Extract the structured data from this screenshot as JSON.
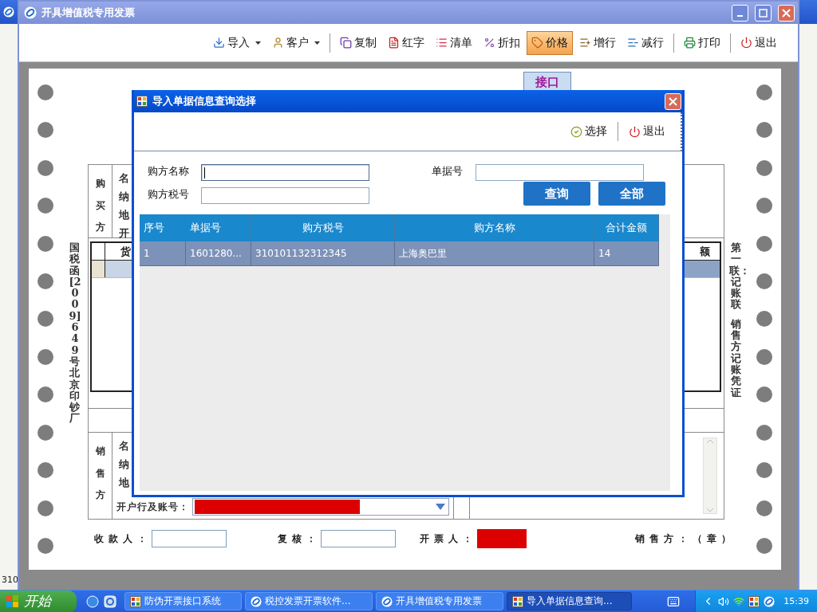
{
  "desktop": {
    "status_text": "310"
  },
  "window": {
    "title": "开具增值税专用发票"
  },
  "toolbar": {
    "groups": [
      [
        {
          "label": "导入",
          "kind": "import",
          "menu": true,
          "selected": false
        },
        {
          "label": "客户",
          "kind": "customer",
          "menu": true,
          "selected": false
        }
      ],
      [
        {
          "label": "复制",
          "kind": "copy",
          "menu": false,
          "selected": false
        },
        {
          "label": "红字",
          "kind": "red",
          "menu": false,
          "selected": false
        },
        {
          "label": "清单",
          "kind": "list",
          "menu": false,
          "selected": false
        },
        {
          "label": "折扣",
          "kind": "discount",
          "menu": false,
          "selected": false
        },
        {
          "label": "价格",
          "kind": "price",
          "menu": false,
          "selected": true
        },
        {
          "label": "增行",
          "kind": "add_row",
          "menu": false,
          "selected": false
        },
        {
          "label": "减行",
          "kind": "remove_row",
          "menu": false,
          "selected": false
        }
      ],
      [
        {
          "label": "打印",
          "kind": "print",
          "menu": false,
          "selected": false
        }
      ],
      [
        {
          "label": "退出",
          "kind": "exit",
          "menu": false,
          "selected": false
        }
      ]
    ]
  },
  "side_tab": {
    "label": "接口"
  },
  "invoice": {
    "left_note": "国税函[2009]649号北京印钞厂",
    "right_note": [
      "第一联：记账联",
      "销售方记账凭证"
    ],
    "buyer": {
      "heading": "购买方",
      "labels": [
        "名",
        "纳",
        "地",
        "开"
      ]
    },
    "goods": {
      "header": [
        "货",
        "额"
      ],
      "rows": [
        {
          "selected": true
        }
      ]
    },
    "seller": {
      "heading": "销售方",
      "labels": [
        "名",
        "纳",
        "地"
      ],
      "bank_label": "开户行及账号："
    },
    "signatures": {
      "payee": "收款人：",
      "reviewer": "复核：",
      "issuer": "开票人：",
      "seal": "销售方：（章）"
    }
  },
  "dialog": {
    "title": "导入单据信息查询选择",
    "actions": [
      {
        "label": "选择",
        "kind": "select"
      },
      {
        "label": "退出",
        "kind": "exit"
      }
    ],
    "fields": [
      {
        "label": "购方名称",
        "focused": true
      },
      {
        "label": "单据号",
        "focused": false
      },
      {
        "label": "购方税号",
        "focused": false
      }
    ],
    "buttons": [
      "查询",
      "全部"
    ],
    "table": {
      "columns": [
        "序号",
        "单据号",
        "购方税号",
        "购方名称",
        "合计金额"
      ],
      "rows": [
        {
          "cells": [
            "1",
            "1601280...",
            "310101132312345",
            "上海奥巴里",
            "14"
          ],
          "selected": true
        }
      ]
    }
  },
  "taskbar": {
    "start": "开始",
    "tasks": [
      {
        "label": "防伪开票接口系统",
        "kind": "app",
        "selected": false
      },
      {
        "label": "税控发票开票软件...",
        "kind": "round",
        "selected": false
      },
      {
        "label": "开具增值税专用发票",
        "kind": "round",
        "selected": false
      },
      {
        "label": "导入单据信息查询...",
        "kind": "app",
        "selected": true
      }
    ],
    "clock": "15:39"
  }
}
